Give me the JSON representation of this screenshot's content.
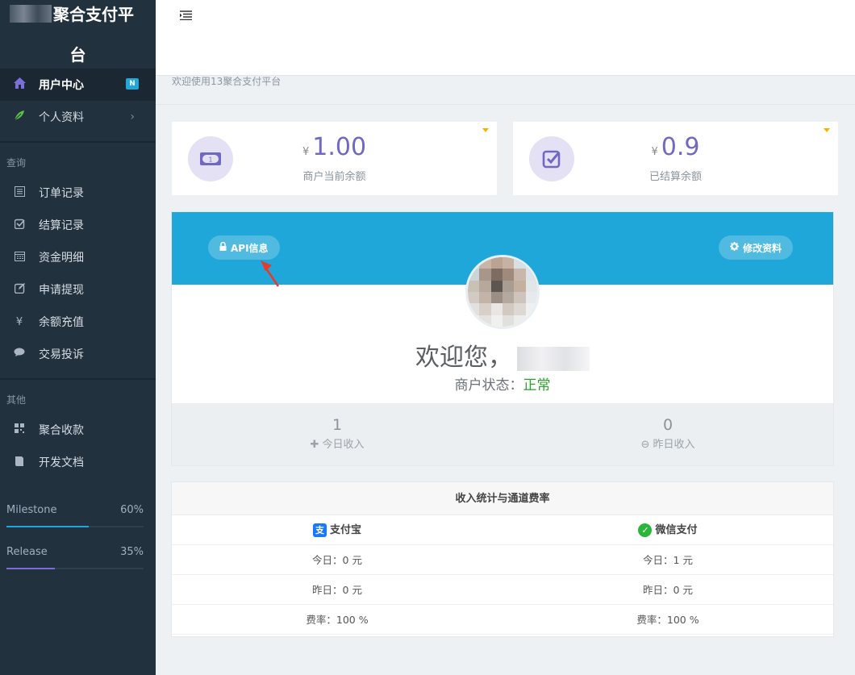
{
  "brand": {
    "title_line1": "聚合支付平",
    "title_line2": "台"
  },
  "sidebar": {
    "items": [
      {
        "label": "用户中心",
        "icon": "home-icon",
        "badge": "N"
      },
      {
        "label": "个人资料",
        "icon": "leaf-icon"
      }
    ],
    "section_query": "查询",
    "query_items": [
      {
        "label": "订单记录",
        "icon": "list-icon"
      },
      {
        "label": "结算记录",
        "icon": "check-square-icon"
      },
      {
        "label": "资金明细",
        "icon": "calendar-icon"
      },
      {
        "label": "申请提现",
        "icon": "edit-icon"
      },
      {
        "label": "余额充值",
        "icon": "yen-icon"
      },
      {
        "label": "交易投诉",
        "icon": "comment-icon"
      }
    ],
    "section_other": "其他",
    "other_items": [
      {
        "label": "聚合收款",
        "icon": "qrcode-icon"
      },
      {
        "label": "开发文档",
        "icon": "book-icon"
      }
    ],
    "progress": [
      {
        "label": "Milestone",
        "value_text": "60%",
        "value": 0.6,
        "color": "#1fa7d9"
      },
      {
        "label": "Release",
        "value_text": "35%",
        "value": 0.35,
        "color": "#7a6fd0"
      }
    ]
  },
  "breadcrumb": "欢迎使用13聚合支付平台",
  "stats": [
    {
      "currency": "¥",
      "value": "1.00",
      "label": "商户当前余额",
      "icon": "money-icon"
    },
    {
      "currency": "¥",
      "value": "0.9",
      "label": "已结算余额",
      "icon": "check-icon"
    }
  ],
  "profile": {
    "api_button": "API信息",
    "edit_button": "修改资料",
    "welcome": "欢迎您，",
    "status_label": "商户状态：",
    "status_value": "正常",
    "today_income_value": "1",
    "today_income_label": "今日收入",
    "yesterday_income_value": "0",
    "yesterday_income_label": "昨日收入"
  },
  "rates": {
    "title": "收入统计与通道费率",
    "alipay": "支付宝",
    "wechat": "微信支付",
    "rows": [
      {
        "left": "今日：0 元",
        "right": "今日：1 元"
      },
      {
        "left": "昨日：0 元",
        "right": "昨日：0 元"
      },
      {
        "left": "费率：100 %",
        "right": "费率：100 %"
      }
    ]
  },
  "colors": {
    "accent": "#1fa7d9",
    "purple": "#6f68c4",
    "sidebar": "#22313e",
    "status_ok": "#2e9e2e"
  }
}
